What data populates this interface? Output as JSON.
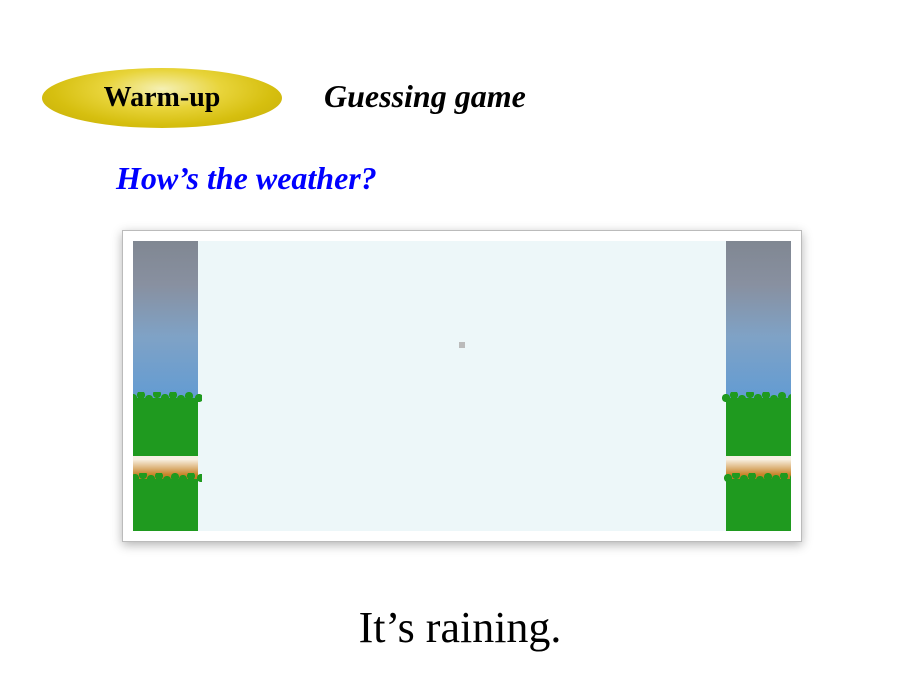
{
  "badge": {
    "label": "Warm-up"
  },
  "subtitle": "Guessing game",
  "question": "How’s the weather?",
  "answer": "It’s raining."
}
